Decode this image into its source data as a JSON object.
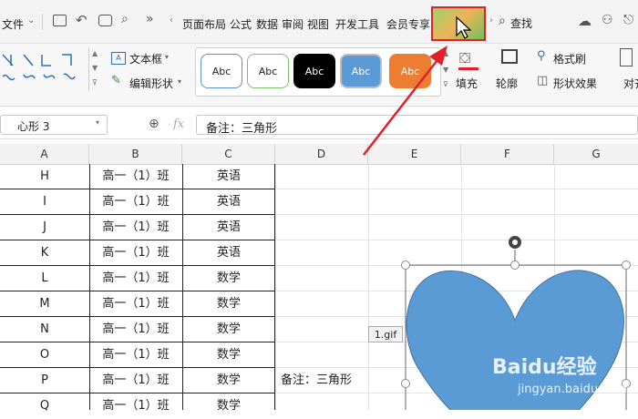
{
  "menubar": {
    "file_label": "文件",
    "tabs": [
      "页面布局",
      "公式",
      "数据",
      "审阅",
      "视图",
      "开发工具",
      "会员专享"
    ],
    "find_label": "查找"
  },
  "ribbon": {
    "textbox_label": "文本框",
    "edit_shape_label": "编辑形状",
    "style_buttons": [
      "Abc",
      "Abc",
      "Abc",
      "Abc",
      "Abc"
    ],
    "style_colors": [
      "#ffffff",
      "#ffffff",
      "#000000",
      "#5b9bd5",
      "#ed7d31"
    ],
    "fill_label": "填充",
    "outline_label": "轮廓",
    "format_painter_label": "格式刷",
    "shape_effect_label": "形状效果",
    "align_label": "对齐"
  },
  "formula_bar": {
    "name_box": "心形 3",
    "fx_label": "fx",
    "formula": "备注：三角形"
  },
  "grid": {
    "columns": [
      "A",
      "B",
      "C",
      "D",
      "E",
      "F",
      "G"
    ],
    "rows": [
      {
        "a": "H",
        "b": "高一（1）班",
        "c": "英语"
      },
      {
        "a": "I",
        "b": "高一（1）班",
        "c": "英语"
      },
      {
        "a": "J",
        "b": "高一（1）班",
        "c": "英语"
      },
      {
        "a": "K",
        "b": "高一（1）班",
        "c": "英语"
      },
      {
        "a": "L",
        "b": "高一（1）班",
        "c": "数学"
      },
      {
        "a": "M",
        "b": "高一（1）班",
        "c": "数学"
      },
      {
        "a": "N",
        "b": "高一（1）班",
        "c": "数学"
      },
      {
        "a": "O",
        "b": "高一（1）班",
        "c": "数学"
      },
      {
        "a": "P",
        "b": "高一（1）班",
        "c": "数学"
      },
      {
        "a": "Q",
        "b": "高一（1）班",
        "c": "数学"
      }
    ],
    "note_d": "备注：三角形"
  },
  "shape": {
    "fill_color": "#5b9bd5",
    "gif_label": "1.gif"
  },
  "annotation_color": "#e0202a",
  "watermark": {
    "brand": "Baidu经验",
    "url": "jingyan.baidu.com"
  }
}
